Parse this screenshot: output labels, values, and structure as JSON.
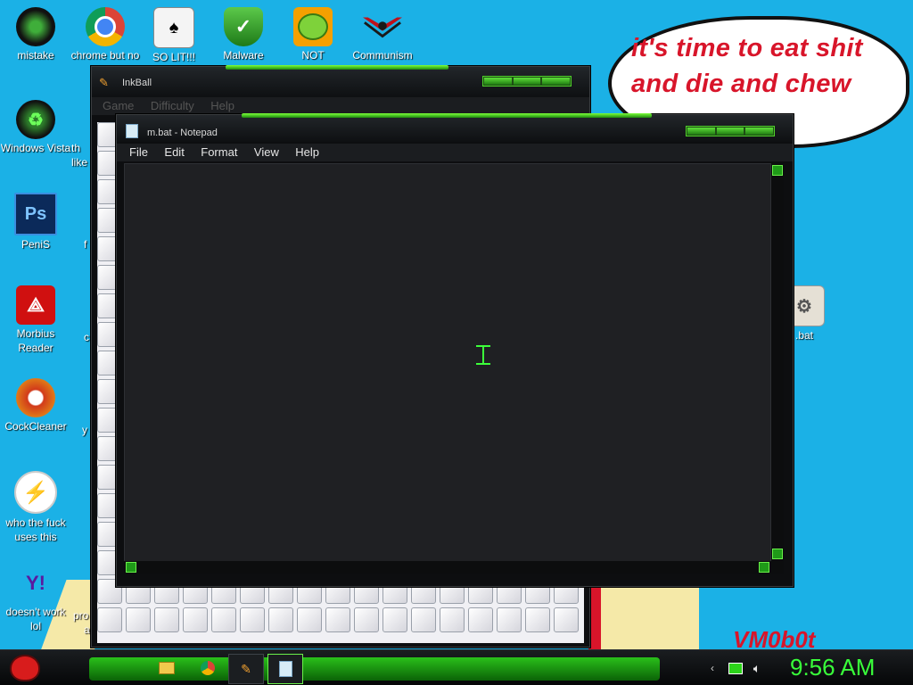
{
  "desktop_icons": [
    {
      "label": "mistake",
      "icon": "mistake-icon",
      "color": "#1d1f1d"
    },
    {
      "label": "chrome but no",
      "icon": "chrome-icon",
      "color": "#ffffff"
    },
    {
      "label": "SO LIT!!!",
      "icon": "solitaire-icon",
      "color": "#e8e8e8"
    },
    {
      "label": "Malware",
      "icon": "shield-icon",
      "color": "#3a9d2c"
    },
    {
      "label": "NOT",
      "icon": "angry-bird-pig-icon",
      "color": "#f5a000"
    },
    {
      "label": "Communism",
      "icon": "emblem-icon",
      "color": "#c0101a"
    },
    {
      "label": "Windows Vista",
      "icon": "recycle-bin-icon",
      "color": "#1d1f1d"
    },
    {
      "label": "PeniS",
      "icon": "photoshop-icon",
      "glyph": "Ps",
      "color": "#0b2a5a"
    },
    {
      "label": "Morbius Reader",
      "icon": "pdf-reader-icon",
      "color": "#d01010"
    },
    {
      "label": "CockCleaner",
      "icon": "ccleaner-icon",
      "color": "#c43a20"
    },
    {
      "label": "who the fuck uses this",
      "icon": "winamp-icon",
      "color": "#ffffff"
    },
    {
      "label": "doesn't work lol",
      "icon": "yahoo-messenger-icon",
      "glyph": "Y!",
      "color": "#5a1aa0"
    },
    {
      "label": ".bat",
      "icon": "bat-file-icon",
      "color": "#e5e0d5"
    }
  ],
  "partial_icon_labels": {
    "a": "th",
    "b": "like",
    "c": "f",
    "d": "c",
    "e": "y",
    "f": "pro",
    "g": "a"
  },
  "wallpaper": {
    "bubble_lines": [
      "it's time to eat shit",
      "and die and chew"
    ],
    "watermark": "VM0b0t"
  },
  "inkball": {
    "title": "InkBall",
    "menu": [
      "Game",
      "Difficulty",
      "Help"
    ]
  },
  "notepad": {
    "title": "m.bat - Notepad",
    "menu": [
      "File",
      "Edit",
      "Format",
      "View",
      "Help"
    ],
    "content": ""
  },
  "taskbar": {
    "start_icon": "angry-bird-start-icon",
    "time": "9:56 AM"
  },
  "colors": {
    "desktop": "#1bb1e6",
    "accent": "#39ff3a",
    "bubble_text": "#d8152a"
  }
}
